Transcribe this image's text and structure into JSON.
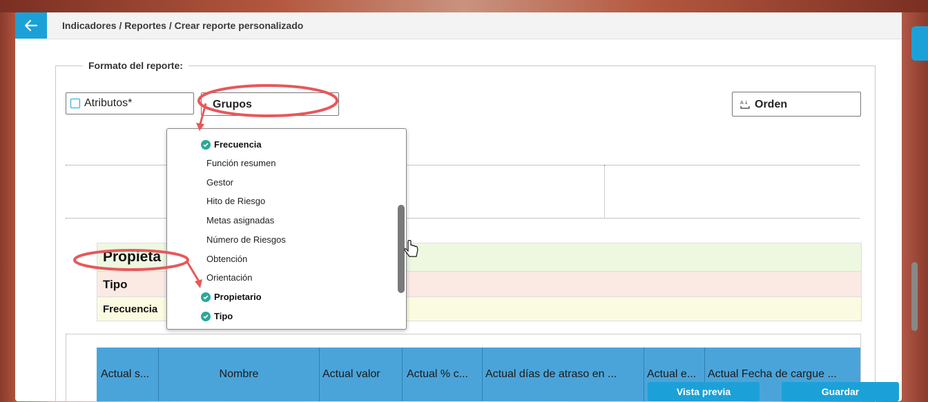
{
  "header": {
    "breadcrumb": "Indicadores / Reportes / Crear reporte personalizado"
  },
  "format": {
    "legend": "Formato del reporte:",
    "attributes_label": "Atributos*",
    "groups_label": "Grupos",
    "order_label": "Orden"
  },
  "dropdown": {
    "items": [
      {
        "label": "Frecuencia",
        "selected": true
      },
      {
        "label": "Función resumen",
        "selected": false
      },
      {
        "label": "Gestor",
        "selected": false
      },
      {
        "label": "Hito de Riesgo",
        "selected": false
      },
      {
        "label": "Metas asignadas",
        "selected": false
      },
      {
        "label": "Número de Riesgos",
        "selected": false
      },
      {
        "label": "Obtención",
        "selected": false
      },
      {
        "label": "Orientación",
        "selected": false
      },
      {
        "label": "Propietario",
        "selected": true
      },
      {
        "label": "Tipo",
        "selected": true
      }
    ]
  },
  "groups": [
    "Propieta",
    "Tipo",
    "Frecuencia"
  ],
  "table": {
    "columns": [
      "Actual s...",
      "Nombre",
      "Actual valor",
      "Actual % c...",
      "Actual días de atraso en ...",
      "Actual e...",
      "Actual Fecha de cargue ..."
    ]
  },
  "buttons": {
    "preview": "Vista previa",
    "save": "Guardar"
  },
  "colors": {
    "accent": "#1ba1d8",
    "check": "#2aa89a",
    "header_blue": "#4ba4d9",
    "annotation": "#e8575a"
  }
}
